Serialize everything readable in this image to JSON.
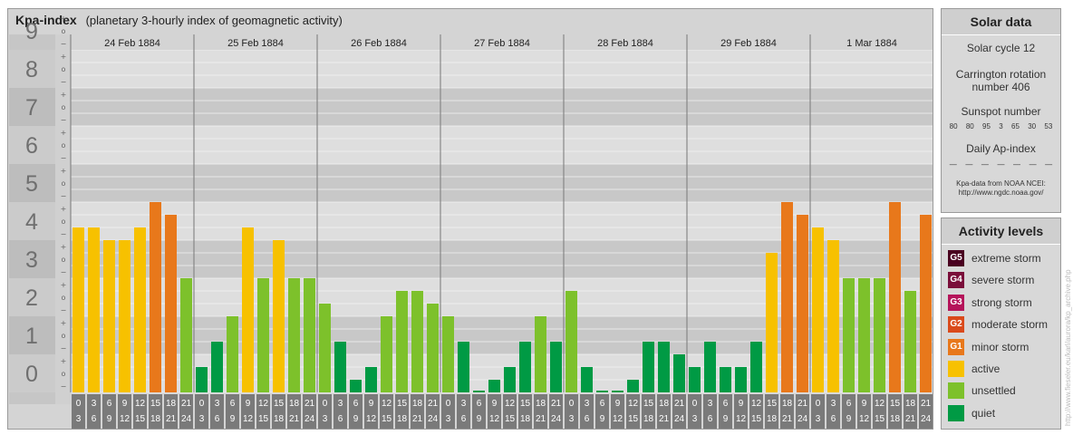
{
  "header": {
    "title": "Kpa-index",
    "subtitle": "(planetary 3-hourly index of geomagnetic activity)"
  },
  "chart_data": {
    "type": "bar",
    "ylim": [
      0,
      9
    ],
    "y_ticks": [
      "0",
      "1",
      "2",
      "3",
      "4",
      "5",
      "6",
      "7",
      "8",
      "9"
    ],
    "sub_ticks": [
      "+",
      "o",
      "−"
    ],
    "dates": [
      "24 Feb 1884",
      "25 Feb 1884",
      "26 Feb 1884",
      "27 Feb 1884",
      "28 Feb 1884",
      "29 Feb 1884",
      "1 Mar 1884"
    ],
    "interval_start": [
      "0",
      "3",
      "6",
      "9",
      "12",
      "15",
      "18",
      "21"
    ],
    "interval_end": [
      "3",
      "6",
      "9",
      "12",
      "15",
      "18",
      "21",
      "24"
    ],
    "values": [
      [
        4.333,
        4.333,
        4,
        4,
        4.333,
        5,
        4.667,
        3
      ],
      [
        0.667,
        1.333,
        2,
        4.333,
        3,
        4,
        3,
        3
      ],
      [
        2.333,
        1.333,
        0.333,
        0.667,
        2,
        2.667,
        2.667,
        2.333
      ],
      [
        2,
        1.333,
        0,
        0.333,
        0.667,
        1.333,
        2,
        1.333
      ],
      [
        2.667,
        0.667,
        0,
        0,
        0.333,
        1.333,
        1.333,
        1
      ],
      [
        0.667,
        1.333,
        0.667,
        0.667,
        1.333,
        3.667,
        5,
        4.667
      ],
      [
        4.333,
        4,
        3,
        3,
        3,
        5,
        2.667,
        4.667
      ]
    ],
    "colors": {
      "quiet": "#009a44",
      "unsettled": "#7dc12b",
      "active": "#f7c100",
      "minor": "#e8781b",
      "moderate": "#da4a1b",
      "strong": "#b5145a",
      "severe": "#7a0e3a",
      "extreme": "#4a0020"
    }
  },
  "solar": {
    "heading": "Solar data",
    "cycle": "Solar cycle 12",
    "carrington_1": "Carrington rotation",
    "carrington_2": "number 406",
    "sunspot_label": "Sunspot number",
    "sunspots": [
      "80",
      "80",
      "95",
      "3",
      "65",
      "30",
      "53"
    ],
    "ap_label": "Daily Ap-index",
    "ap_values": [
      "—",
      "—",
      "—",
      "—",
      "—",
      "—",
      "—"
    ],
    "source_1": "Kpa-data from NOAA NCEI:",
    "source_2": "http://www.ngdc.noaa.gov/"
  },
  "activity": {
    "heading": "Activity levels",
    "items": [
      {
        "code": "G5",
        "label": "extreme storm",
        "color": "#4a0020"
      },
      {
        "code": "G4",
        "label": "severe storm",
        "color": "#7a0e3a"
      },
      {
        "code": "G3",
        "label": "strong storm",
        "color": "#b5145a"
      },
      {
        "code": "G2",
        "label": "moderate storm",
        "color": "#da4a1b"
      },
      {
        "code": "G1",
        "label": "minor storm",
        "color": "#e8781b"
      },
      {
        "code": "",
        "label": "active",
        "color": "#f7c100"
      },
      {
        "code": "",
        "label": "unsettled",
        "color": "#7dc12b"
      },
      {
        "code": "",
        "label": "quiet",
        "color": "#009a44"
      }
    ]
  },
  "credit": "http://www.fieseler.eu/karl/aurora/kp_archive.php"
}
